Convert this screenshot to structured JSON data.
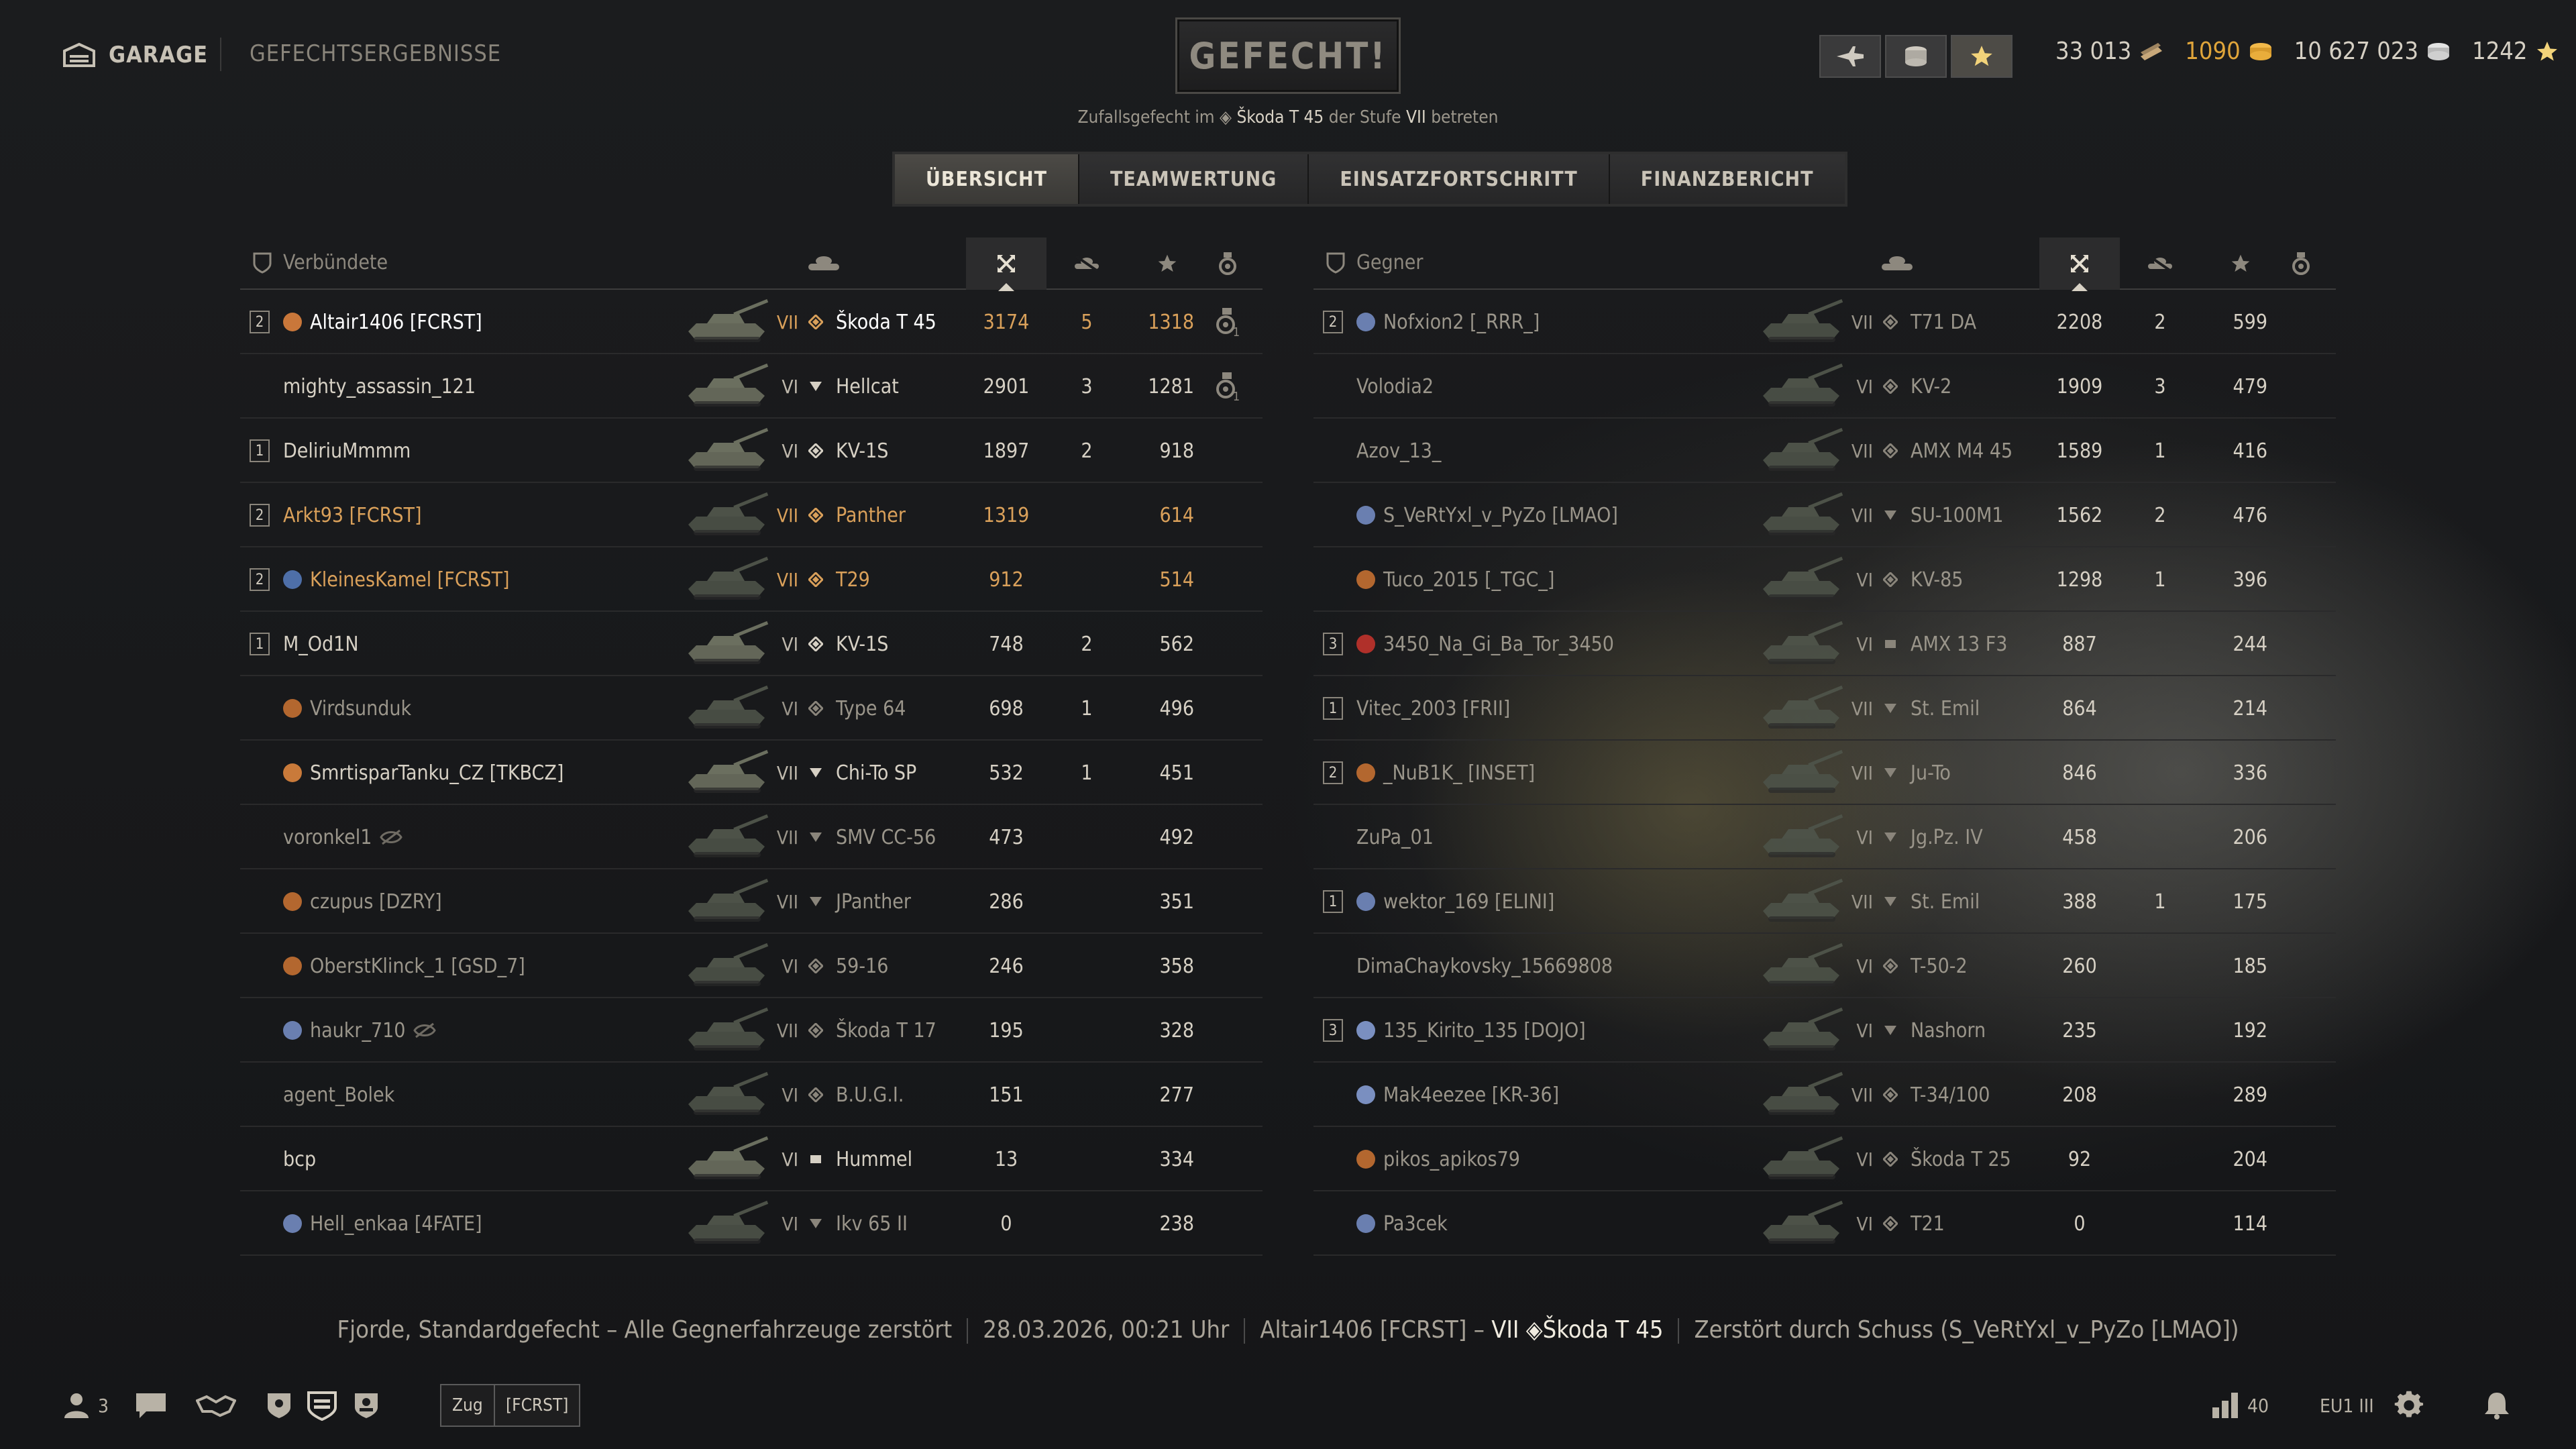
{
  "header": {
    "garage_label": "GARAGE",
    "results_title": "GEFECHTSERGEBNISSE",
    "fight_button": "GEFECHT!",
    "subtitle_prefix": "Zufallsgefecht im",
    "subtitle_tank": "Škoda T 45",
    "subtitle_mid": "der Stufe",
    "subtitle_tier": "VII",
    "subtitle_suffix": "betreten"
  },
  "currency": {
    "bonds": "33 013",
    "gold": "1090",
    "credits": "10 627 023",
    "free_xp": "1242",
    "colors": {
      "gold": "#e0a53a",
      "bonds": "#c8a87a",
      "credits": "#cfd0d0",
      "xp": "#e6c46a"
    }
  },
  "tabs": [
    "ÜBERSICHT",
    "TEAMWERTUNG",
    "EINSATZFORTSCHRITT",
    "FINANZBERICHT"
  ],
  "left": {
    "team_label": "Verbündete",
    "rows": [
      {
        "platoon": "2",
        "emblem": "#c9773a",
        "name": "Altair1406 [FCRST]",
        "tier": "VII",
        "cls": "medium",
        "tank": "Škoda T 45",
        "dmg": "3174",
        "kills": "5",
        "xp": "1318",
        "medal": "1",
        "style": "clan",
        "alive": true
      },
      {
        "platoon": "",
        "emblem": "",
        "name": "mighty_assassin_121",
        "tier": "VI",
        "cls": "td",
        "tank": "Hellcat",
        "dmg": "2901",
        "kills": "3",
        "xp": "1281",
        "medal": "1",
        "style": "",
        "alive": true
      },
      {
        "platoon": "1",
        "emblem": "",
        "name": "DeliriuMmmm",
        "tier": "VI",
        "cls": "heavy",
        "tank": "KV-1S",
        "dmg": "1897",
        "kills": "2",
        "xp": "918",
        "medal": "",
        "style": "",
        "alive": true
      },
      {
        "platoon": "2",
        "emblem": "",
        "name": "Arkt93 [FCRST]",
        "tier": "VII",
        "cls": "medium",
        "tank": "Panther",
        "dmg": "1319",
        "kills": "",
        "xp": "614",
        "medal": "",
        "style": "clan",
        "alive": false
      },
      {
        "platoon": "2",
        "emblem": "#4e6fa8",
        "name": "KleinesKamel [FCRST]",
        "tier": "VII",
        "cls": "medium",
        "tank": "T29",
        "dmg": "912",
        "kills": "",
        "xp": "514",
        "medal": "",
        "style": "clan",
        "alive": false
      },
      {
        "platoon": "1",
        "emblem": "",
        "name": "M_Od1N",
        "tier": "VI",
        "cls": "heavy",
        "tank": "KV-1S",
        "dmg": "748",
        "kills": "2",
        "xp": "562",
        "medal": "",
        "style": "",
        "alive": true
      },
      {
        "platoon": "",
        "emblem": "#b3672f",
        "name": "Virdsunduk",
        "tier": "VI",
        "cls": "medium",
        "tank": "Type 64",
        "dmg": "698",
        "kills": "1",
        "xp": "496",
        "medal": "",
        "style": "dead",
        "alive": false
      },
      {
        "platoon": "",
        "emblem": "#c97a3a",
        "name": "SmrtisparTanku_CZ [TKBCZ]",
        "tier": "VII",
        "cls": "td",
        "tank": "Chi-To SP",
        "dmg": "532",
        "kills": "1",
        "xp": "451",
        "medal": "",
        "style": "",
        "alive": true
      },
      {
        "platoon": "",
        "emblem": "",
        "name": "voronkel1",
        "tier": "VII",
        "cls": "td",
        "tank": "SMV CC-56",
        "dmg": "473",
        "kills": "",
        "xp": "492",
        "medal": "",
        "style": "dead",
        "alive": false
      },
      {
        "platoon": "",
        "emblem": "#b3672f",
        "name": "czupus [DZRY]",
        "tier": "VII",
        "cls": "td",
        "tank": "JPanther",
        "dmg": "286",
        "kills": "",
        "xp": "351",
        "medal": "",
        "style": "dead",
        "alive": false
      },
      {
        "platoon": "",
        "emblem": "#b3672f",
        "name": "OberstKlinck_1 [GSD_7]",
        "tier": "VI",
        "cls": "medium",
        "tank": "59-16",
        "dmg": "246",
        "kills": "",
        "xp": "358",
        "medal": "",
        "style": "dead",
        "alive": false
      },
      {
        "platoon": "",
        "emblem": "#6a7fb0",
        "name": "haukr_710",
        "tier": "VII",
        "cls": "medium",
        "tank": "Škoda T 17",
        "dmg": "195",
        "kills": "",
        "xp": "328",
        "medal": "",
        "style": "dead",
        "alive": false
      },
      {
        "platoon": "",
        "emblem": "",
        "name": "agent_Bolek",
        "tier": "VI",
        "cls": "medium",
        "tank": "B.U.G.I.",
        "dmg": "151",
        "kills": "",
        "xp": "277",
        "medal": "",
        "style": "dead",
        "alive": false
      },
      {
        "platoon": "",
        "emblem": "",
        "name": "bcp",
        "tier": "VI",
        "cls": "spg",
        "tank": "Hummel",
        "dmg": "13",
        "kills": "",
        "xp": "334",
        "medal": "",
        "style": "",
        "alive": true
      },
      {
        "platoon": "",
        "emblem": "#6a7fb0",
        "name": "Hell_enkaa [4FATE]",
        "tier": "VI",
        "cls": "td",
        "tank": "Ikv 65 II",
        "dmg": "0",
        "kills": "",
        "xp": "238",
        "medal": "",
        "style": "dead",
        "alive": false
      }
    ]
  },
  "right": {
    "team_label": "Gegner",
    "rows": [
      {
        "platoon": "2",
        "emblem": "#6a7fb0",
        "name": "Nofxion2 [_RRR_]",
        "tier": "VII",
        "cls": "medium",
        "tank": "T71 DA",
        "dmg": "2208",
        "kills": "2",
        "xp": "599",
        "medal": "",
        "style": "dead",
        "alive": false
      },
      {
        "platoon": "",
        "emblem": "",
        "name": "Volodia2",
        "tier": "VI",
        "cls": "heavy",
        "tank": "KV-2",
        "dmg": "1909",
        "kills": "3",
        "xp": "479",
        "medal": "",
        "style": "dead",
        "alive": false
      },
      {
        "platoon": "",
        "emblem": "",
        "name": "Azov_13_",
        "tier": "VII",
        "cls": "medium",
        "tank": "AMX M4 45",
        "dmg": "1589",
        "kills": "1",
        "xp": "416",
        "medal": "",
        "style": "dead",
        "alive": false
      },
      {
        "platoon": "",
        "emblem": "#6a7fb0",
        "name": "S_VeRtYxl_v_PyZo [LMAO]",
        "tier": "VII",
        "cls": "td",
        "tank": "SU-100M1",
        "dmg": "1562",
        "kills": "2",
        "xp": "476",
        "medal": "",
        "style": "dead",
        "alive": false
      },
      {
        "platoon": "",
        "emblem": "#b3672f",
        "name": "Tuco_2015 [_TGC_]",
        "tier": "VI",
        "cls": "medium",
        "tank": "KV-85",
        "dmg": "1298",
        "kills": "1",
        "xp": "396",
        "medal": "",
        "style": "dead",
        "alive": false
      },
      {
        "platoon": "3",
        "emblem": "#b0302a",
        "name": "3450_Na_Gi_Ba_Tor_3450",
        "tier": "VI",
        "cls": "spg",
        "tank": "AMX 13 F3",
        "dmg": "887",
        "kills": "",
        "xp": "244",
        "medal": "",
        "style": "dead",
        "alive": false
      },
      {
        "platoon": "1",
        "emblem": "",
        "name": "Vitec_2003 [FRII]",
        "tier": "VII",
        "cls": "td",
        "tank": "St. Emil",
        "dmg": "864",
        "kills": "",
        "xp": "214",
        "medal": "",
        "style": "dead",
        "alive": false
      },
      {
        "platoon": "2",
        "emblem": "#b3672f",
        "name": "_NuB1K_ [INSET]",
        "tier": "VII",
        "cls": "td",
        "tank": "Ju-To",
        "dmg": "846",
        "kills": "",
        "xp": "336",
        "medal": "",
        "style": "dead",
        "alive": false
      },
      {
        "platoon": "",
        "emblem": "",
        "name": "ZuPa_01",
        "tier": "VI",
        "cls": "td",
        "tank": "Jg.Pz. IV",
        "dmg": "458",
        "kills": "",
        "xp": "206",
        "medal": "",
        "style": "dead",
        "alive": false
      },
      {
        "platoon": "1",
        "emblem": "#6a7fb0",
        "name": "wektor_169 [ELINI]",
        "tier": "VII",
        "cls": "td",
        "tank": "St. Emil",
        "dmg": "388",
        "kills": "1",
        "xp": "175",
        "medal": "",
        "style": "dead",
        "alive": false
      },
      {
        "platoon": "",
        "emblem": "",
        "name": "DimaChaykovsky_15669808",
        "tier": "VI",
        "cls": "medium",
        "tank": "T-50-2",
        "dmg": "260",
        "kills": "",
        "xp": "185",
        "medal": "",
        "style": "dead",
        "alive": false
      },
      {
        "platoon": "3",
        "emblem": "#7a8fc0",
        "name": "135_Kirito_135 [DOJO]",
        "tier": "VI",
        "cls": "td",
        "tank": "Nashorn",
        "dmg": "235",
        "kills": "",
        "xp": "192",
        "medal": "",
        "style": "dead",
        "alive": false
      },
      {
        "platoon": "",
        "emblem": "#7a8fc0",
        "name": "Mak4eezee [KR-36]",
        "tier": "VII",
        "cls": "medium",
        "tank": "T-34/100",
        "dmg": "208",
        "kills": "",
        "xp": "289",
        "medal": "",
        "style": "dead",
        "alive": false
      },
      {
        "platoon": "",
        "emblem": "#b3672f",
        "name": "pikos_apikos79",
        "tier": "VI",
        "cls": "medium",
        "tank": "Škoda T 25",
        "dmg": "92",
        "kills": "",
        "xp": "204",
        "medal": "",
        "style": "dead",
        "alive": false
      },
      {
        "platoon": "",
        "emblem": "#6a7fb0",
        "name": "Pa3cek",
        "tier": "VI",
        "cls": "medium",
        "tank": "T21",
        "dmg": "0",
        "kills": "",
        "xp": "114",
        "medal": "",
        "style": "dead",
        "alive": false
      }
    ]
  },
  "footer": {
    "battle": "Fjorde, Standardgefecht – Alle Gegnerfahrzeuge zerstört",
    "datetime": "28.03.2026, 00:21 Uhr",
    "player": "Altair1406 [FCRST] –",
    "player_tier": "VII",
    "player_tank": "Škoda T 45",
    "death": "Zerstört durch Schuss (S_VeRtYxl_v_PyZo [LMAO])"
  },
  "bottombar": {
    "friends_count": "3",
    "platoon_chip": "Zug",
    "clan_chip": "[FCRST]",
    "online_count": "40",
    "server": "EU1 III"
  }
}
